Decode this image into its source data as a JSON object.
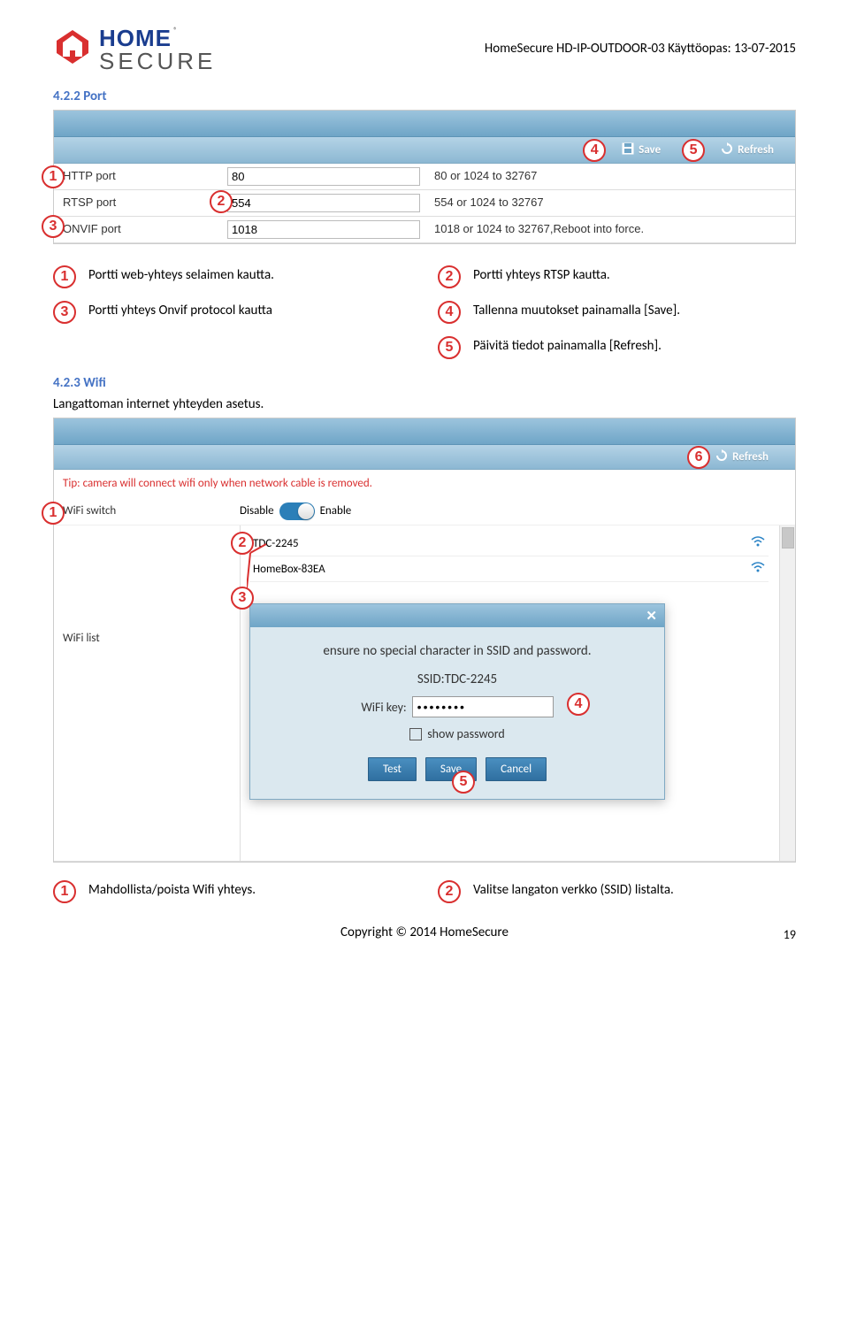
{
  "header": {
    "logo_home": "HOME",
    "logo_secure": "SECURE",
    "doc_title": "HomeSecure HD-IP-OUTDOOR-03 Käyttöopas: 13-07-2015"
  },
  "section1": {
    "title": "4.2.2 Port",
    "save_label": "Save",
    "refresh_label": "Refresh",
    "rows": [
      {
        "label": "HTTP port",
        "value": "80",
        "hint": "80 or 1024 to 32767"
      },
      {
        "label": "RTSP port",
        "value": "554",
        "hint": "554 or 1024 to 32767"
      },
      {
        "label": "ONVIF port",
        "value": "1018",
        "hint": "1018 or 1024 to 32767,Reboot into force."
      }
    ],
    "markers": [
      "1",
      "2",
      "3",
      "4",
      "5"
    ]
  },
  "legend1": {
    "left": [
      {
        "num": "1",
        "text": "Portti web-yhteys selaimen kautta."
      },
      {
        "num": "3",
        "text": "Portti yhteys Onvif protocol kautta"
      }
    ],
    "right": [
      {
        "num": "2",
        "text": "Portti yhteys RTSP kautta."
      },
      {
        "num": "4",
        "text": "Tallenna muutokset painamalla [Save]."
      },
      {
        "num": "5",
        "text": "Päivitä tiedot painamalla [Refresh]."
      }
    ]
  },
  "section2": {
    "title": "4.2.3 Wifi",
    "subtitle": "Langattoman internet yhteyden asetus.",
    "refresh_label": "Refresh",
    "tip": "Tip: camera will connect wifi only when network cable is removed.",
    "switch_label": "WiFi switch",
    "disable": "Disable",
    "enable": "Enable",
    "list_label": "WiFi list",
    "networks": [
      {
        "name": "TDC-2245"
      },
      {
        "name": "HomeBox-83EA"
      }
    ],
    "modal": {
      "note": "ensure no special character in SSID and password.",
      "ssid_label": "SSID:",
      "ssid_value": "TDC-2245",
      "key_label": "WiFi key:",
      "key_value": "••••••••",
      "show_pw": "show password",
      "btn_test": "Test",
      "btn_save": "Save",
      "btn_cancel": "Cancel"
    },
    "markers": [
      "1",
      "2",
      "3",
      "4",
      "5",
      "6"
    ]
  },
  "legend2": {
    "left": {
      "num": "1",
      "text": "Mahdollista/poista Wifi yhteys."
    },
    "right": {
      "num": "2",
      "text": "Valitse langaton verkko (SSID) listalta."
    }
  },
  "footer": {
    "copyright": "Copyright © 2014 HomeSecure",
    "page": "19"
  }
}
